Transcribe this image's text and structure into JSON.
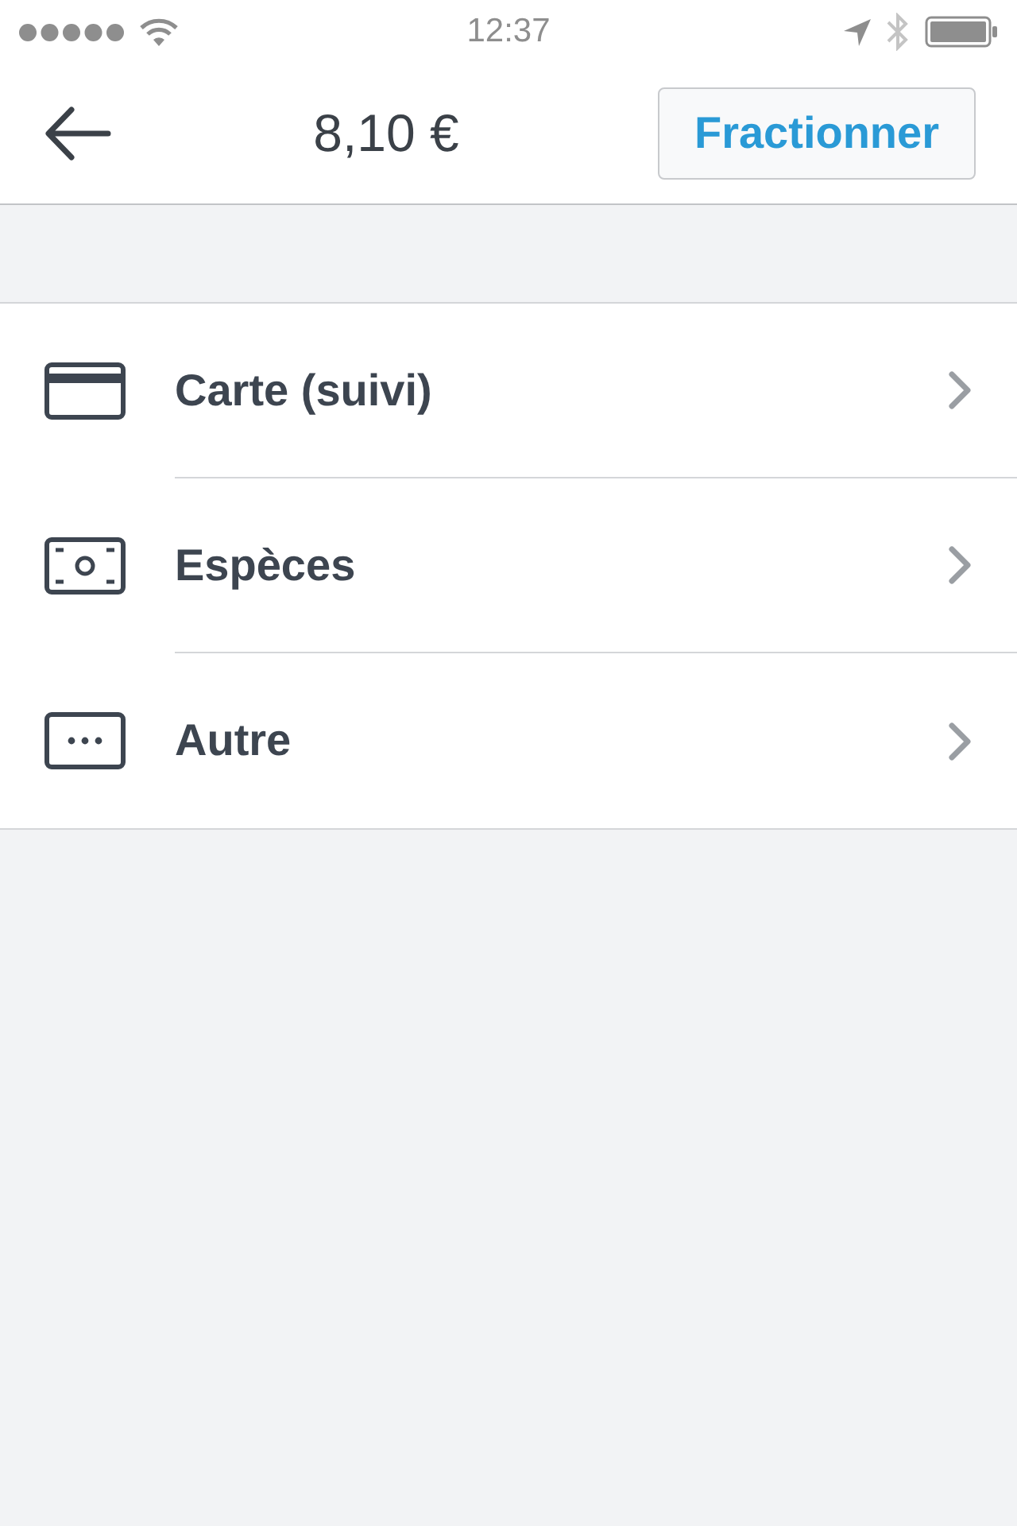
{
  "status_bar": {
    "time": "12:37"
  },
  "nav_bar": {
    "title": "8,10 €",
    "action": "Fractionner"
  },
  "payment_methods": [
    {
      "kind": "card",
      "label": "Carte (suivi)"
    },
    {
      "kind": "cash",
      "label": "Espèces"
    },
    {
      "kind": "other",
      "label": "Autre"
    }
  ]
}
